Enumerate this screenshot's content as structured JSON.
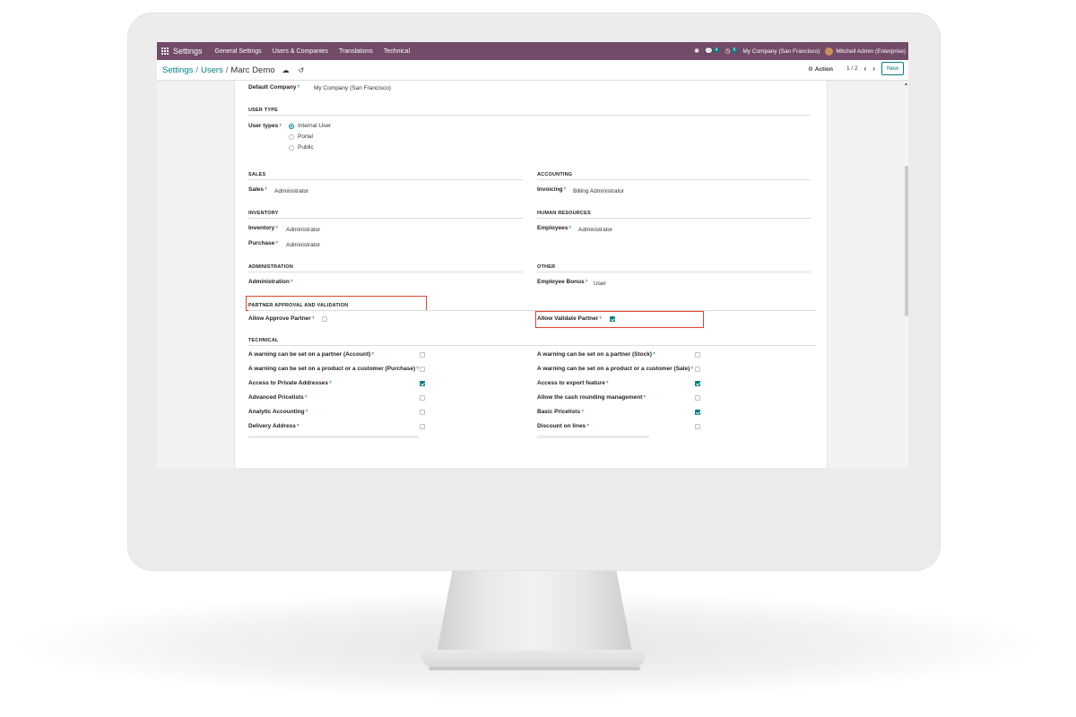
{
  "navbar": {
    "app_name": "Settings",
    "menu": [
      "General Settings",
      "Users & Companies",
      "Translations",
      "Technical"
    ],
    "messages_count": "4",
    "activities_count": "5",
    "company": "My Company (San Francisco)",
    "user": "Mitchell Admin (Enterprise)"
  },
  "control": {
    "breadcrumb": [
      "Settings",
      "Users",
      "Marc Demo"
    ],
    "action_label": "Action",
    "pager": "1 / 2",
    "new_label": "New"
  },
  "form": {
    "default_company_label": "Default Company",
    "default_company_value": "My Company (San Francisco)",
    "user_type_title": "USER TYPE",
    "user_types_label": "User types",
    "user_type_options": [
      "Internal User",
      "Portal",
      "Public"
    ],
    "user_type_selected": "Internal User",
    "sales": {
      "title": "SALES",
      "label": "Sales",
      "value": "Administrator"
    },
    "accounting": {
      "title": "ACCOUNTING",
      "label": "Invoicing",
      "value": "Billing Administrator"
    },
    "inventory": {
      "title": "INVENTORY",
      "inventory_label": "Inventory",
      "inventory_value": "Administrator",
      "purchase_label": "Purchase",
      "purchase_value": "Administrator"
    },
    "hr": {
      "title": "HUMAN RESOURCES",
      "label": "Employees",
      "value": "Administrator"
    },
    "administration": {
      "title": "ADMINISTRATION",
      "label": "Administration",
      "value": ""
    },
    "other": {
      "title": "OTHER",
      "label": "Employee Bonus",
      "value": "User"
    },
    "partner": {
      "title": "PARTNER APPROVAL AND VALIDATION",
      "approve_label": "Allow Approve Partner",
      "approve_checked": false,
      "validate_label": "Allow Validate Partner",
      "validate_checked": true
    },
    "technical_title": "TECHNICAL",
    "technical_left": [
      {
        "label": "A warning can be set on a partner (Account)",
        "checked": false
      },
      {
        "label": "A warning can be set on a product or a customer (Purchase)",
        "checked": false
      },
      {
        "label": "Access to Private Addresses",
        "checked": true
      },
      {
        "label": "Advanced Pricelists",
        "checked": false
      },
      {
        "label": "Analytic Accounting",
        "checked": false
      },
      {
        "label": "Delivery Address",
        "checked": false
      }
    ],
    "technical_right": [
      {
        "label": "A warning can be set on a partner (Stock)",
        "checked": false
      },
      {
        "label": "A warning can be set on a product or a customer (Sale)",
        "checked": false
      },
      {
        "label": "Access to export feature",
        "checked": true
      },
      {
        "label": "Allow the cash rounding management",
        "checked": false
      },
      {
        "label": "Basic Pricelists",
        "checked": true
      },
      {
        "label": "Discount on lines",
        "checked": false
      }
    ]
  },
  "colors": {
    "navbar": "#714b67",
    "accent": "#017e84",
    "highlight": "#e0442f"
  }
}
